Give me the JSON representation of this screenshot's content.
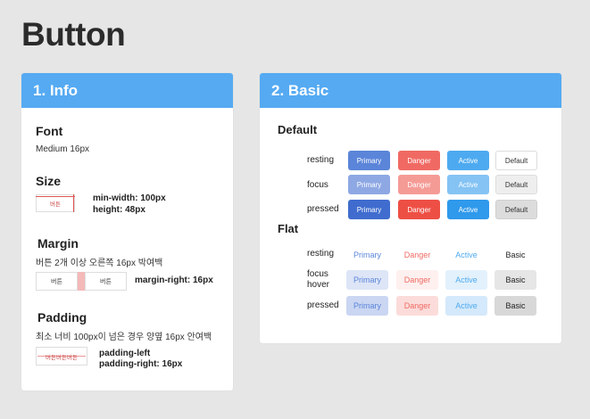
{
  "page": {
    "title": "Button"
  },
  "info": {
    "header": "1. Info",
    "font": {
      "title": "Font",
      "value": "Medium 16px"
    },
    "size": {
      "title": "Size",
      "demo_label": "버튼",
      "note_1": "min-width: 100px",
      "note_2": "height: 48px"
    },
    "margin": {
      "title": "Margin",
      "desc": "버튼 2개 이상 오른쪽 16px 박여백",
      "demo_left": "버튼",
      "demo_right": "버튼",
      "note": "margin-right: 16px"
    },
    "padding": {
      "title": "Padding",
      "desc": "최소 너비 100px이 넘은 경우 양옆 16px 안여백",
      "demo_label": "버튼버튼버튼",
      "note_1": "padding-left",
      "note_2": "padding-right: 16px"
    }
  },
  "basic": {
    "header": "2. Basic",
    "default": {
      "title": "Default",
      "rows": [
        {
          "label": "resting",
          "primary": "Primary",
          "danger": "Danger",
          "active": "Active",
          "default": "Default"
        },
        {
          "label": "focus",
          "primary": "Primary",
          "danger": "Danger",
          "active": "Active",
          "default": "Default"
        },
        {
          "label": "pressed",
          "primary": "Primary",
          "danger": "Danger",
          "active": "Active",
          "default": "Default"
        }
      ]
    },
    "flat": {
      "title": "Flat",
      "rows": [
        {
          "label": "resting",
          "primary": "Primary",
          "danger": "Danger",
          "active": "Active",
          "basic": "Basic"
        },
        {
          "label_1": "focus",
          "label_2": "hover",
          "primary": "Primary",
          "danger": "Danger",
          "active": "Active",
          "basic": "Basic"
        },
        {
          "label": "pressed",
          "primary": "Primary",
          "danger": "Danger",
          "active": "Active",
          "basic": "Basic"
        }
      ]
    }
  },
  "colors": {
    "header": "#55aaf2",
    "primary": "#5b85d9",
    "danger": "#f06a63",
    "active": "#4eaaf0",
    "default_border": "#dddddd"
  }
}
